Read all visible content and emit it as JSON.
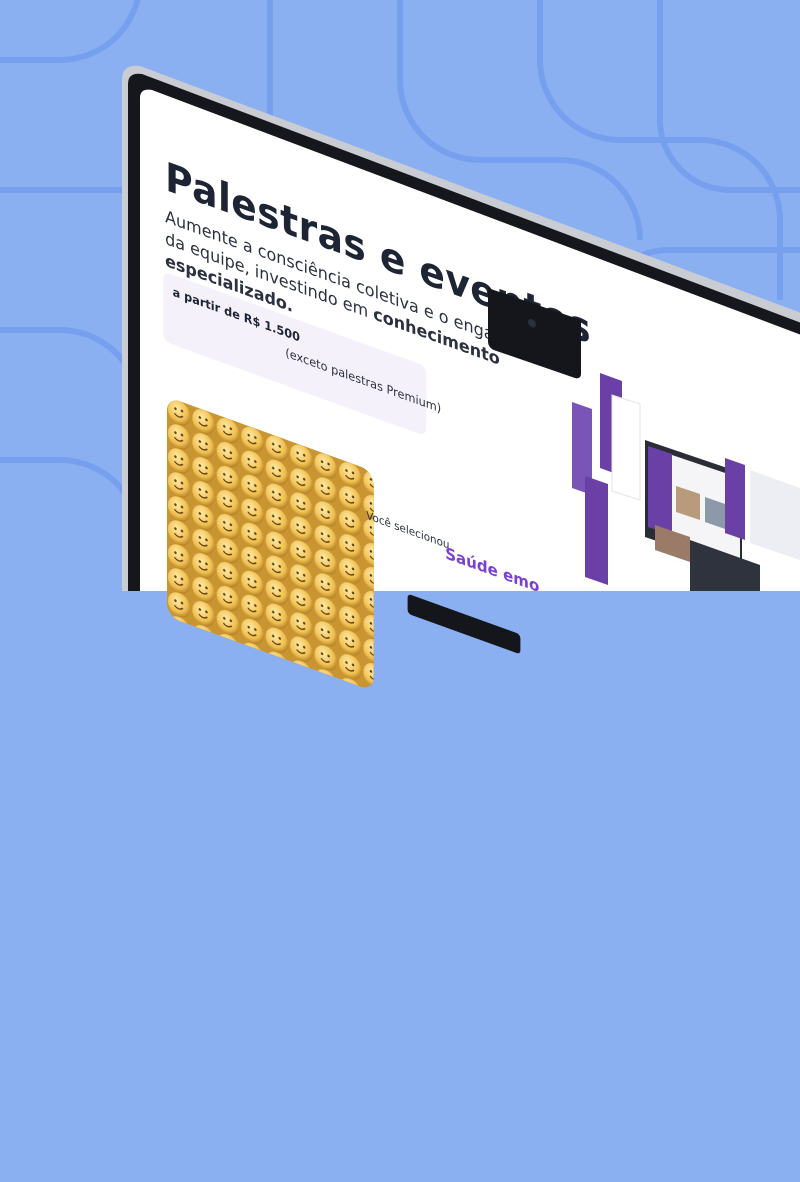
{
  "page": {
    "title": "Palestras e eventos",
    "subtitle_plain": "Aumente a consciência coletiva e o engajamento da equipe, investindo em ",
    "subtitle_bold": "conhecimento especializado.",
    "price": "a partir de R$ 1.500",
    "price_note": "(exceto palestras Premium)",
    "selected_label": "Você selecionou",
    "selected_value": "Saúde emo"
  },
  "colors": {
    "background": "#8bb0f2",
    "accent_purple": "#7b3fd6",
    "bezel": "#14161c"
  },
  "icons": [
    "smiley-balls-image",
    "camera-icon"
  ]
}
